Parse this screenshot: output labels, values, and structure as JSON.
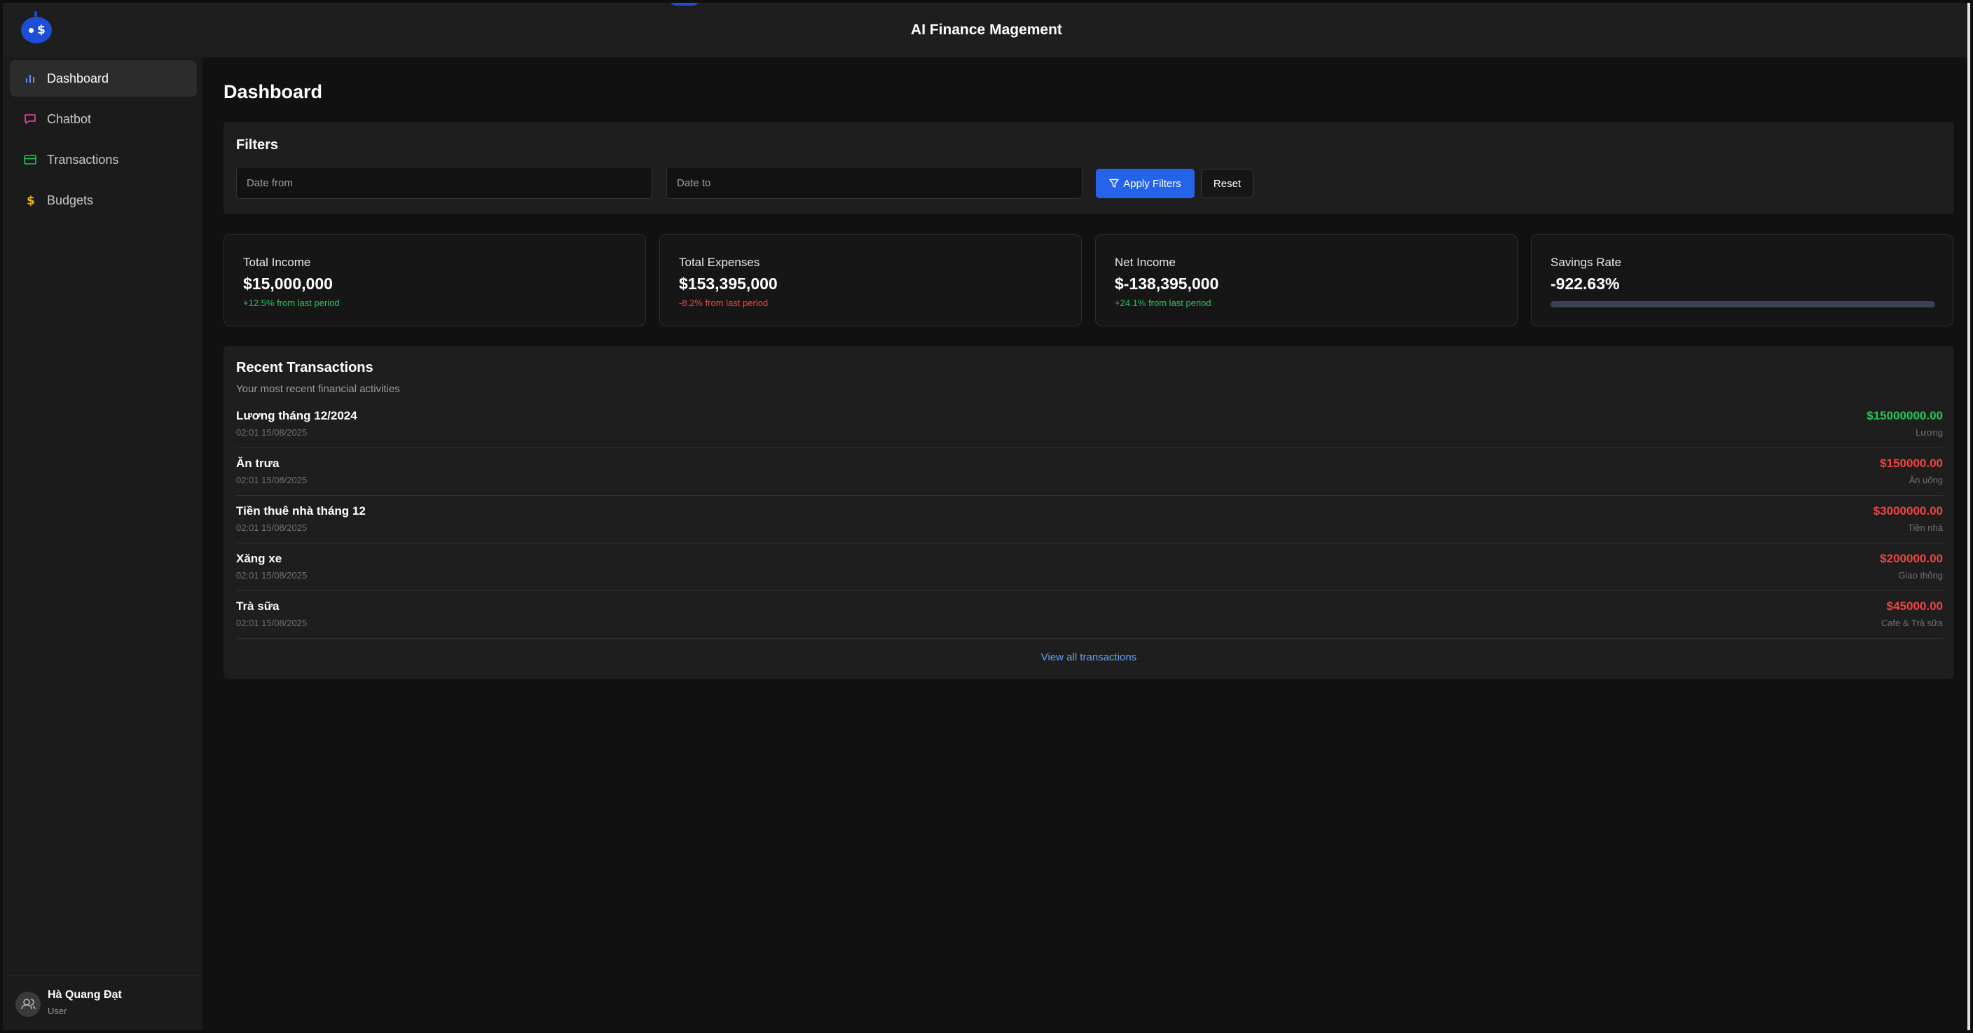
{
  "app": {
    "title": "AI Finance Magement"
  },
  "sidebar": {
    "items": [
      {
        "label": "Dashboard",
        "icon": "bar-chart-icon",
        "active": true
      },
      {
        "label": "Chatbot",
        "icon": "message-square-icon",
        "active": false
      },
      {
        "label": "Transactions",
        "icon": "credit-card-icon",
        "active": false
      },
      {
        "label": "Budgets",
        "icon": "dollar-icon",
        "active": false
      }
    ],
    "user": {
      "name": "Hà Quang Đạt",
      "role": "User"
    }
  },
  "page": {
    "title": "Dashboard"
  },
  "filters": {
    "title": "Filters",
    "date_from_placeholder": "Date from",
    "date_to_placeholder": "Date to",
    "apply_label": "Apply Filters",
    "reset_label": "Reset"
  },
  "stats": [
    {
      "label": "Total Income",
      "value": "$15,000,000",
      "change": "+12.5% from last period",
      "trend": "positive"
    },
    {
      "label": "Total Expenses",
      "value": "$153,395,000",
      "change": "-8.2% from last period",
      "trend": "negative"
    },
    {
      "label": "Net Income",
      "value": "$-138,395,000",
      "change": "+24.1% from last period",
      "trend": "positive"
    },
    {
      "label": "Savings Rate",
      "value": "-922.63%",
      "progress_percent": 0
    }
  ],
  "recent": {
    "title": "Recent Transactions",
    "subtitle": "Your most recent financial activities",
    "transactions": [
      {
        "name": "Lương tháng 12/2024",
        "date": "02:01 15/08/2025",
        "amount": "$15000000.00",
        "category": "Lương",
        "type": "income"
      },
      {
        "name": "Ăn trưa",
        "date": "02:01 15/08/2025",
        "amount": "$150000.00",
        "category": "Ăn uống",
        "type": "expense"
      },
      {
        "name": "Tiền thuê nhà tháng 12",
        "date": "02:01 15/08/2025",
        "amount": "$3000000.00",
        "category": "Tiền nhà",
        "type": "expense"
      },
      {
        "name": "Xăng xe",
        "date": "02:01 15/08/2025",
        "amount": "$200000.00",
        "category": "Giao thông",
        "type": "expense"
      },
      {
        "name": "Trà sữa",
        "date": "02:01 15/08/2025",
        "amount": "$45000.00",
        "category": "Cafe & Trà sữa",
        "type": "expense"
      }
    ],
    "view_all_label": "View all transactions"
  },
  "colors": {
    "accent": "#2563eb",
    "income": "#22c55e",
    "expense": "#ef4444",
    "link": "#60a5fa"
  }
}
